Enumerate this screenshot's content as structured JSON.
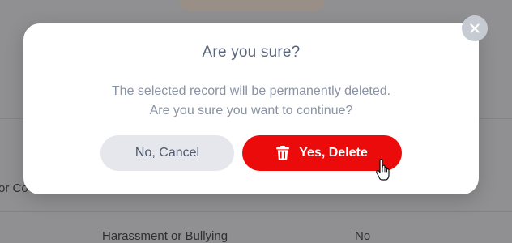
{
  "background": {
    "row_left_fragment": "or Co",
    "row_category": "Harassment or Bullying",
    "row_value": "No"
  },
  "dialog": {
    "title": "Are you sure?",
    "message_line1": "The selected record will be permanently deleted.",
    "message_line2": "Are you sure you want to continue?",
    "cancel_label": "No, Cancel",
    "confirm_label": "Yes, Delete",
    "confirm_icon": "trash-icon",
    "close_icon": "close-icon"
  },
  "colors": {
    "confirm": "#ec0b0b",
    "cancel": "#e5e7ec",
    "title": "#59657a",
    "message": "#8a93a3"
  },
  "cursor": "pointer-hand"
}
